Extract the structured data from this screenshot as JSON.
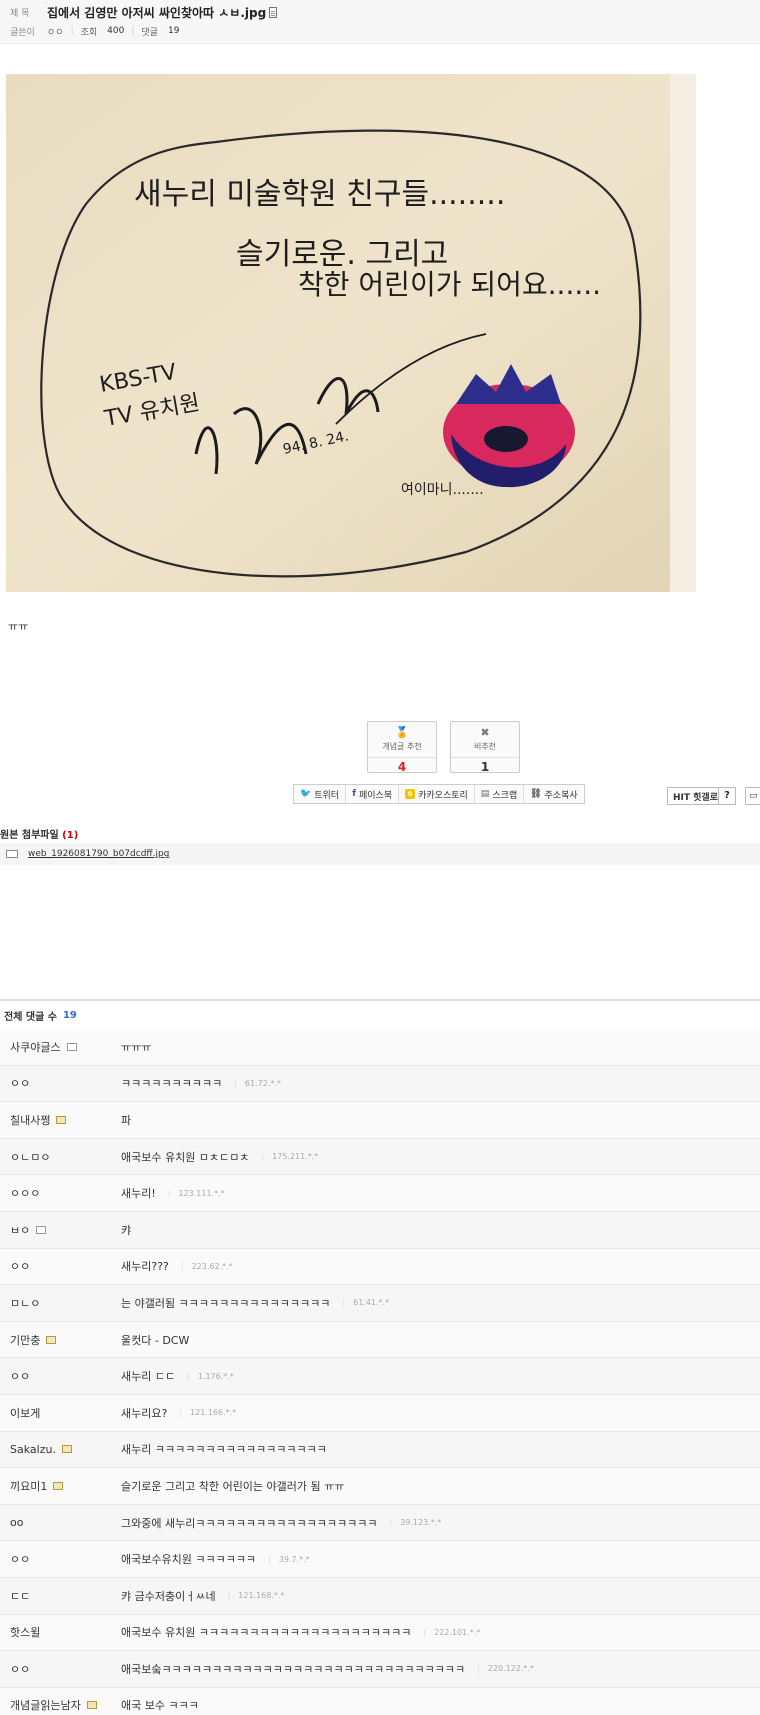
{
  "post": {
    "title_label": "제 목",
    "title": "집에서 김영만 아저씨 싸인찾아따 ㅅㅂ.jpg",
    "author_label": "글쓴이",
    "author": "ㅇㅇ",
    "views_label": "조회",
    "views": "400",
    "comments_label": "댓글",
    "comments_count": "19",
    "body_text": "ㅠㅠ"
  },
  "image": {
    "line1": "새누리 미술학원 친구들........",
    "line2": "슬기로운.    그리고",
    "line3": "착한 어린이가 되어요......",
    "kbs1": "KBS-TV",
    "kbs2": "TV 유치원",
    "date": "94. 8. 24.",
    "mom": "여이마니......."
  },
  "votes": {
    "up_label": "개념글 추천",
    "up_count": "4",
    "down_label": "비추천",
    "down_count": "1"
  },
  "share": {
    "twitter": "트위터",
    "facebook": "페이스북",
    "kakaostory": "카카오스토리",
    "scrap": "스크랩",
    "copy": "주소복사",
    "hit": "HIT 힛갤로",
    "help": "?"
  },
  "attachment": {
    "title": "원본 첨부파일",
    "count": "(1)",
    "filename": "web_1926081790_b07dcdff.jpg"
  },
  "comment_section": {
    "label": "전체 댓글 수",
    "count": "19",
    "items": [
      {
        "name": "사쿠야글스",
        "badge": "fixed",
        "text": "ㅠㅠㅠ",
        "ip": ""
      },
      {
        "name": "ㅇㅇ",
        "badge": "",
        "text": "ㅋㅋㅋㅋㅋㅋㅋㅋㅋㅋ",
        "ip": "61.72.*.*"
      },
      {
        "name": "칠내사쩡",
        "badge": "gall",
        "text": "파",
        "ip": ""
      },
      {
        "name": "ㅇㄴㅁㅇ",
        "badge": "",
        "text": "애국보수 유치원 ㅁㅊㄷㅁㅊ",
        "ip": "175.211.*.*"
      },
      {
        "name": "ㅇㅇㅇ",
        "badge": "",
        "text": "새누리!",
        "ip": "123.111.*.*"
      },
      {
        "name": "ㅂㅇ",
        "badge": "fixed",
        "text": "캬",
        "ip": ""
      },
      {
        "name": "ㅇㅇ",
        "badge": "",
        "text": "새누리???",
        "ip": "223.62.*.*"
      },
      {
        "name": "ㅁㄴㅇ",
        "badge": "",
        "text": "는 야갤러됨 ㅋㅋㅋㅋㅋㅋㅋㅋㅋㅋㅋㅋㅋㅋㅋ",
        "ip": "61.41.*.*"
      },
      {
        "name": "기만충",
        "badge": "gall",
        "text": "울컷다 - DCW",
        "ip": ""
      },
      {
        "name": "ㅇㅇ",
        "badge": "",
        "text": "새누리 ㄷㄷ",
        "ip": "1.176.*.*"
      },
      {
        "name": "이보게",
        "badge": "",
        "text": "새누리요?",
        "ip": "121.166.*.*"
      },
      {
        "name": "Sakalzu.",
        "badge": "gall",
        "text": "새누리 ㅋㅋㅋㅋㅋㅋㅋㅋㅋㅋㅋㅋㅋㅋㅋㅋㅋ",
        "ip": ""
      },
      {
        "name": "끼요미1",
        "badge": "gall",
        "text": "슬기로운 그리고 착한 어린이는 야갤러가 됨 ㅠㅠ",
        "ip": ""
      },
      {
        "name": "oo",
        "badge": "",
        "text": "그와중에 새누리ㅋㅋㅋㅋㅋㅋㅋㅋㅋㅋㅋㅋㅋㅋㅋㅋㅋㅋ",
        "ip": "39.123.*.*"
      },
      {
        "name": "ㅇㅇ",
        "badge": "",
        "text": "애국보수유치원 ㅋㅋㅋㅋㅋㅋ",
        "ip": "39.7.*.*"
      },
      {
        "name": "ㄷㄷ",
        "badge": "",
        "text": "캬 금수저충이ㅓㅆ네",
        "ip": "121.168.*.*"
      },
      {
        "name": "핫스윌",
        "badge": "",
        "text": "애국보수 유치원 ㅋㅋㅋㅋㅋㅋㅋㅋㅋㅋㅋㅋㅋㅋㅋㅋㅋㅋㅋㅋㅋ",
        "ip": "222.101.*.*"
      },
      {
        "name": "ㅇㅇ",
        "badge": "",
        "text": "애국보숰ㅋㅋㅋㅋㅋㅋㅋㅋㅋㅋㅋㅋㅋㅋㅋㅋㅋㅋㅋㅋㅋㅋㅋㅋㅋㅋㅋㅋㅋㅋ",
        "ip": "220.122.*.*"
      },
      {
        "name": "개념글읽는남자",
        "badge": "gall",
        "text": "애국 보수 ㅋㅋㅋ",
        "ip": ""
      }
    ]
  }
}
